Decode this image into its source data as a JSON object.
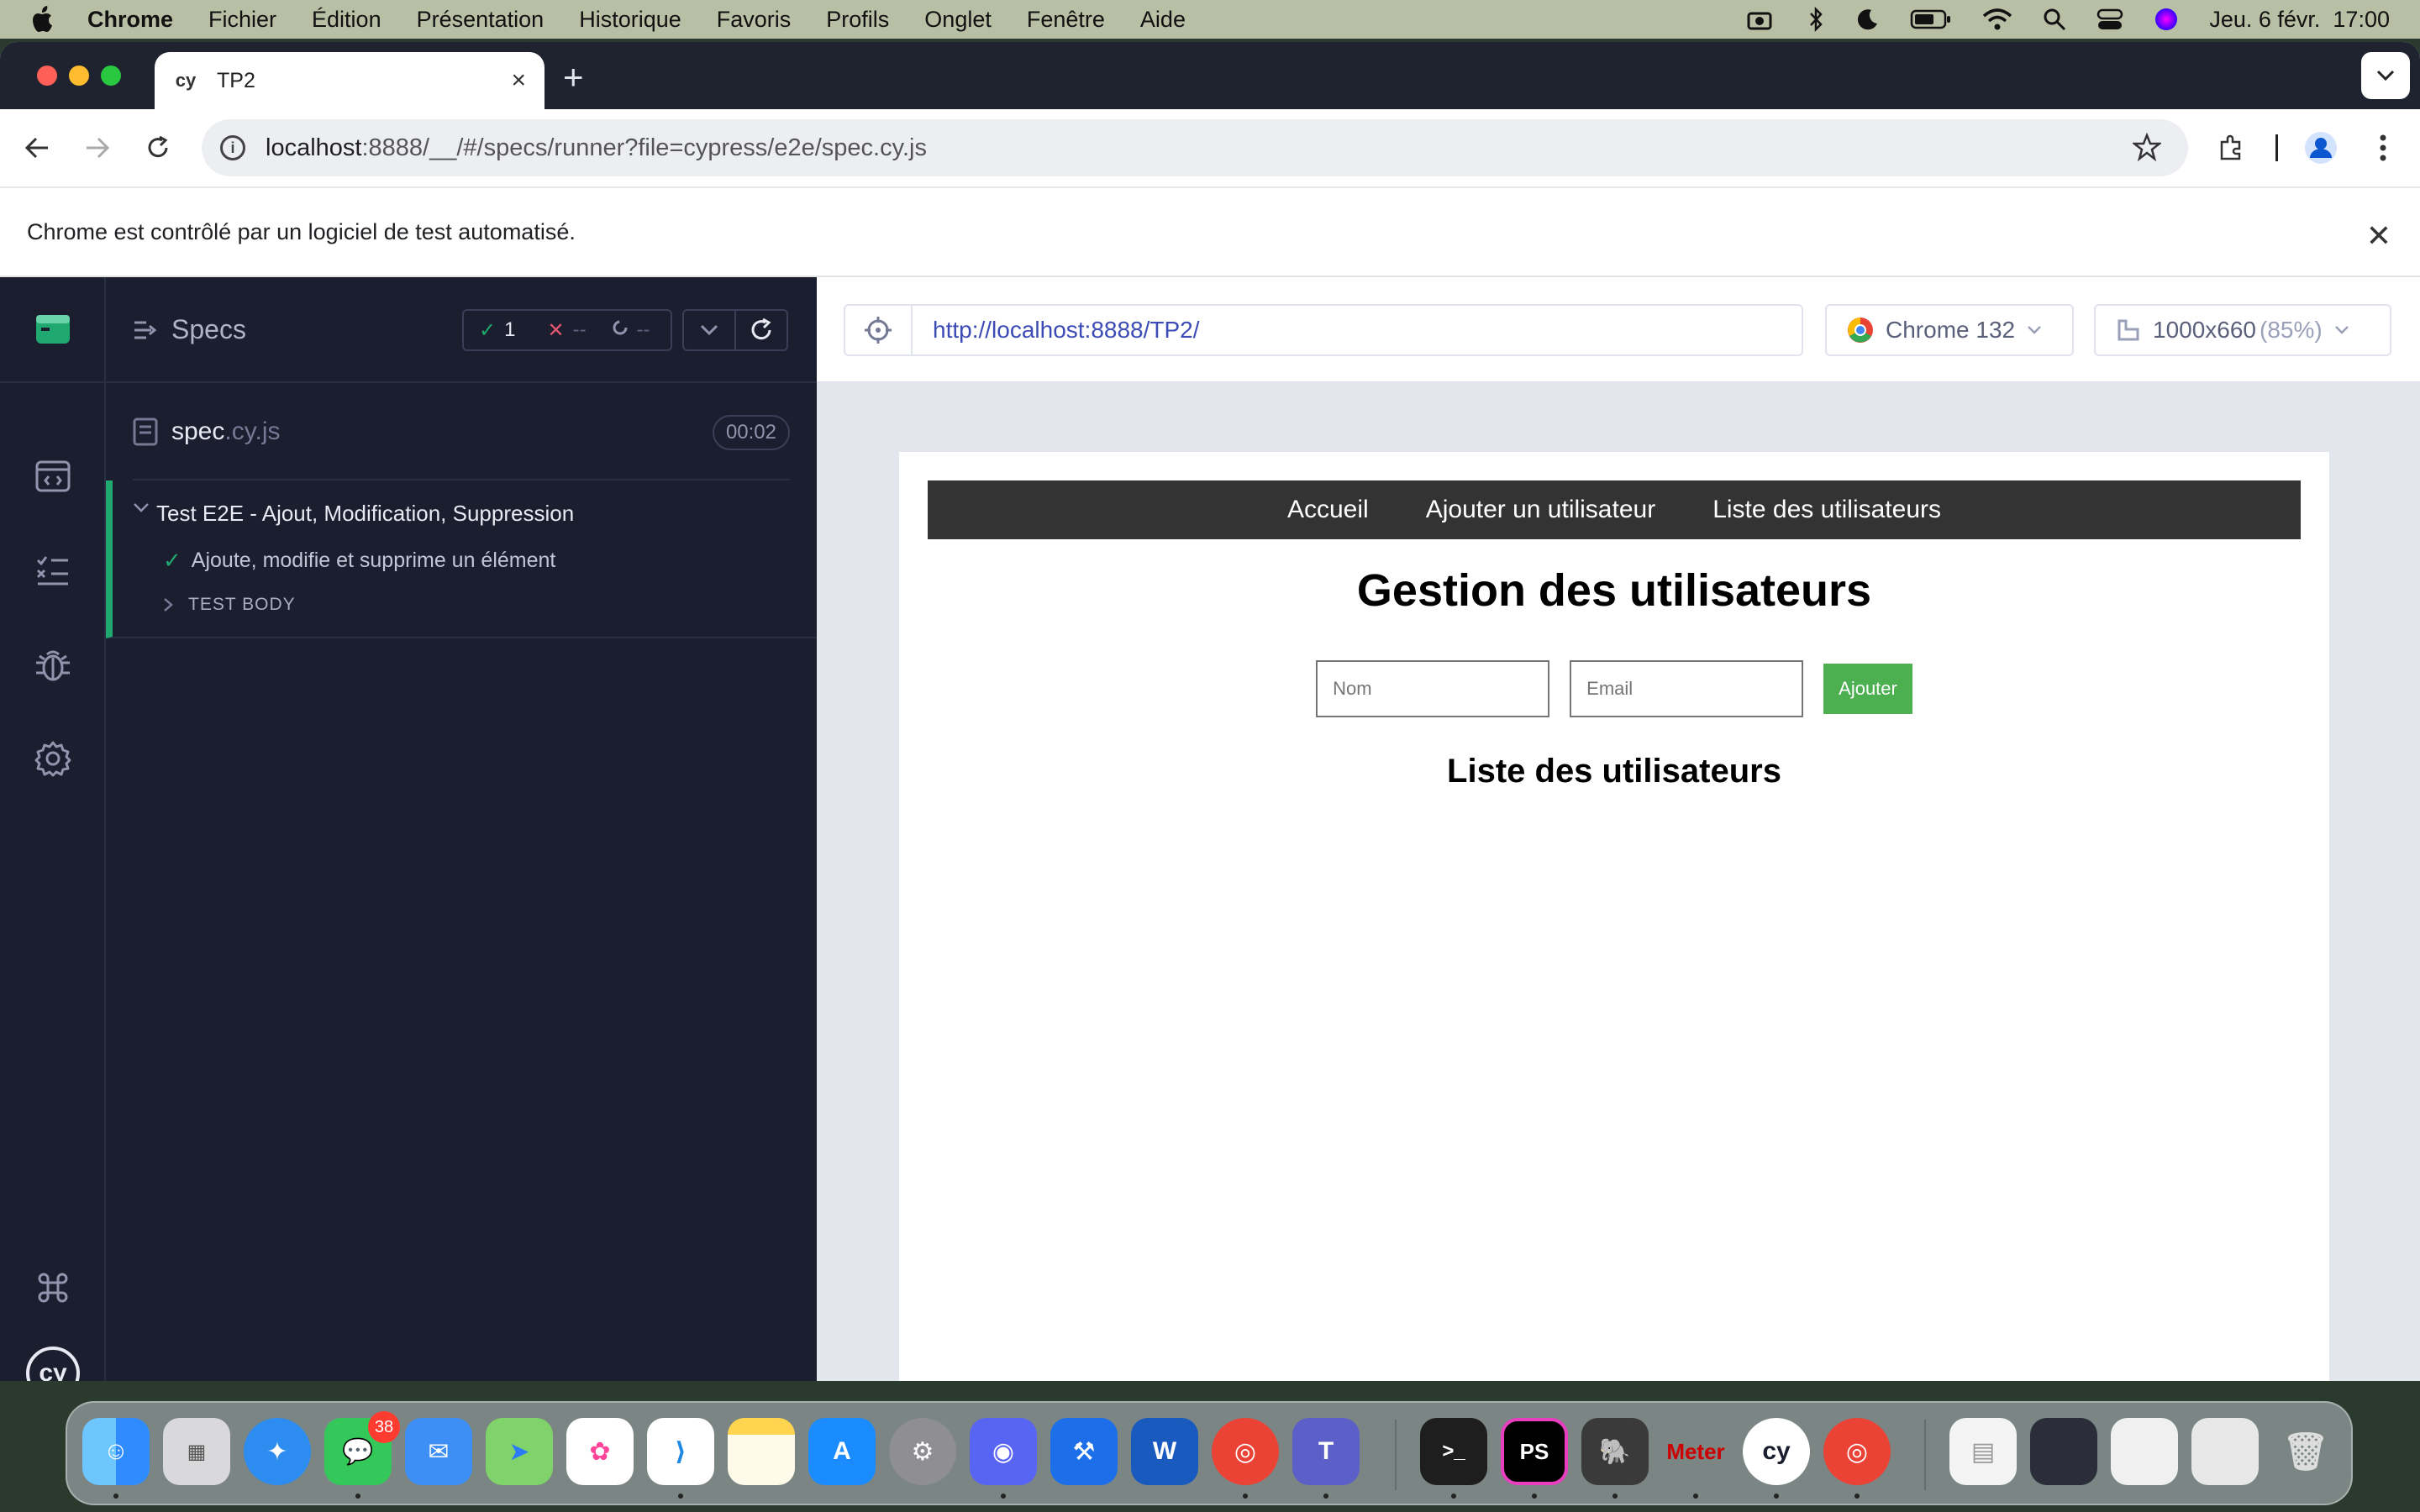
{
  "menubar": {
    "app": "Chrome",
    "items": [
      "Fichier",
      "Édition",
      "Présentation",
      "Historique",
      "Favoris",
      "Profils",
      "Onglet",
      "Fenêtre",
      "Aide"
    ],
    "datetime": "Jeu. 6 févr.  17:00"
  },
  "browser": {
    "tab_title": "TP2",
    "tab_favicon": "cy",
    "url_host": "localhost",
    "url_rest": ":8888/__/#/specs/runner?file=cypress/e2e/spec.cy.js",
    "infobar_text": "Chrome est contrôlé par un logiciel de test automatisé."
  },
  "reporter": {
    "header": "Specs",
    "passed": "1",
    "failed": "--",
    "pending": "--",
    "spec_name": "spec",
    "spec_ext": ".cy.js",
    "duration": "00:02",
    "suite_title": "Test E2E - Ajout, Modification, Suppression",
    "test_title": "Ajoute, modifie et supprime un élément",
    "test_body": "TEST BODY"
  },
  "aut": {
    "url": "http://localhost:8888/TP2/",
    "browser": "Chrome 132",
    "viewport": "1000x660",
    "scale": "(85%)"
  },
  "app": {
    "nav": [
      "Accueil",
      "Ajouter un utilisateur",
      "Liste des utilisateurs"
    ],
    "heading": "Gestion des utilisateurs",
    "name_placeholder": "Nom",
    "email_placeholder": "Email",
    "add_button": "Ajouter",
    "list_heading": "Liste des utilisateurs"
  },
  "dock": {
    "messages_badge": "38",
    "apps": [
      "finder-icon",
      "launchpad-icon",
      "safari-icon",
      "messages-icon",
      "mail-icon",
      "maps-icon",
      "photos-icon",
      "vscode-icon",
      "notes-icon",
      "app-store-icon",
      "system-settings-icon",
      "discord-icon",
      "xcode-icon",
      "word-icon",
      "chrome-icon",
      "teams-icon",
      "terminal-icon",
      "phpstorm-icon",
      "tableplus-icon",
      "jmeter-icon",
      "cypress-icon",
      "chrome-icon",
      "downloads-stack-icon",
      "screenshot-icon",
      "screenshot-icon",
      "screenshot-icon",
      "trash-icon"
    ]
  }
}
